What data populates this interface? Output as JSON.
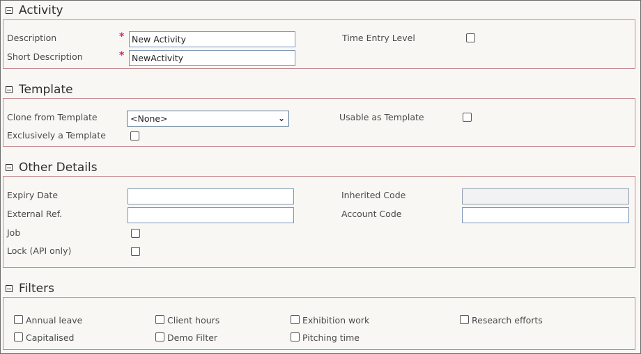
{
  "activity": {
    "title": "Activity",
    "description_label": "Description",
    "description_value": "New Activity",
    "short_description_label": "Short Description",
    "short_description_value": "NewActivity",
    "required_mark": "*",
    "time_entry_level_label": "Time Entry Level"
  },
  "template": {
    "title": "Template",
    "clone_label": "Clone from Template",
    "clone_value": "<None>",
    "usable_label": "Usable as Template",
    "exclusive_label": "Exclusively a Template"
  },
  "other": {
    "title": "Other Details",
    "expiry_label": "Expiry Date",
    "external_ref_label": "External Ref.",
    "job_label": "Job",
    "lock_label": "Lock (API only)",
    "inherited_label": "Inherited Code",
    "account_label": "Account Code"
  },
  "filters": {
    "title": "Filters",
    "items": [
      {
        "label": "Annual leave"
      },
      {
        "label": "Client hours"
      },
      {
        "label": "Exhibition work"
      },
      {
        "label": "Research efforts"
      },
      {
        "label": "Capitalised"
      },
      {
        "label": "Demo Filter"
      },
      {
        "label": "Pitching time"
      }
    ]
  }
}
